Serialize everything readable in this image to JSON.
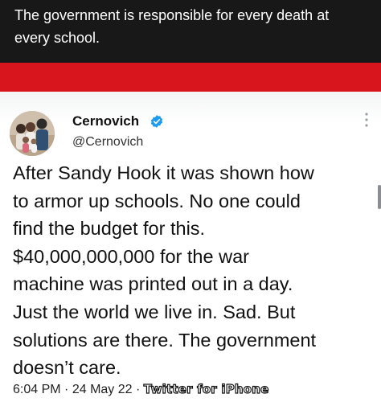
{
  "caption": {
    "text": "The government is responsible for every death at every school."
  },
  "tweet": {
    "author_name": "Cernovich",
    "author_handle": "@Cernovich",
    "verified": true,
    "text": "After Sandy Hook it was shown how\nto armor up schools. No one could\nfind the budget for this.\n$40,000,000,000 for the war\nmachine was printed out in a day.\nJust the world we live in. Sad. But\nsolutions are there. The government\ndoesn’t care.",
    "time": "6:04 PM",
    "separator": "·",
    "date": "24 May 22",
    "client": "Twitter for iPhone"
  },
  "colors": {
    "caption_bg": "#181818",
    "band_red": "#d8141d",
    "verified_blue": "#1d9bf0"
  },
  "icons": [
    "avatar",
    "verified-badge-icon",
    "more-options-icon"
  ]
}
